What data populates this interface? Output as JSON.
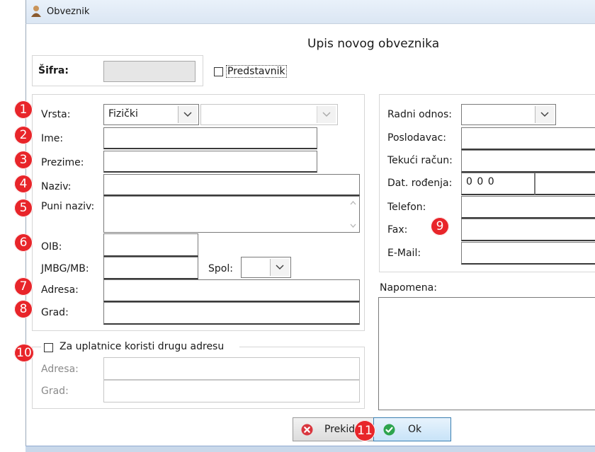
{
  "window": {
    "title": "Obveznik"
  },
  "form": {
    "heading": "Upis novog obveznika",
    "sifra": {
      "label": "Šifra:",
      "value": ""
    },
    "predstavnik": {
      "label": "Predstavnik",
      "checked": false
    },
    "left": {
      "vrsta": {
        "label": "Vrsta:",
        "value": "Fizički",
        "second_value": ""
      },
      "ime": {
        "label": "Ime:",
        "value": ""
      },
      "prezime": {
        "label": "Prezime:",
        "value": ""
      },
      "naziv": {
        "label": "Naziv:",
        "value": ""
      },
      "puni_naziv": {
        "label": "Puni naziv:",
        "value": ""
      },
      "oib": {
        "label": "OIB:",
        "value": ""
      },
      "jmbg": {
        "label": "JMBG/MB:",
        "value": ""
      },
      "spol": {
        "label": "Spol:",
        "value": ""
      },
      "adresa": {
        "label": "Adresa:",
        "value": ""
      },
      "grad": {
        "label": "Grad:",
        "value": ""
      }
    },
    "alt_address": {
      "checkbox_label": "Za uplatnice koristi drugu adresu",
      "checked": false,
      "adresa": {
        "label": "Adresa:",
        "value": ""
      },
      "grad": {
        "label": "Grad:",
        "value": ""
      }
    },
    "right": {
      "radni_odnos": {
        "label": "Radni odnos:",
        "value": ""
      },
      "poslodavac": {
        "label": "Poslodavac:",
        "value": ""
      },
      "tekuci_racun": {
        "label": "Tekući račun:",
        "value": ""
      },
      "dat_rodjenja": {
        "label": "Dat. rođenja:",
        "value": "0 0 0"
      },
      "telefon": {
        "label": "Telefon:",
        "value": ""
      },
      "fax": {
        "label": "Fax:",
        "value": ""
      },
      "email": {
        "label": "E-Mail:",
        "value": ""
      },
      "napomena": {
        "label": "Napomena:",
        "value": ""
      }
    }
  },
  "buttons": {
    "cancel": "Prekid",
    "ok": "Ok"
  },
  "annotations": [
    "1",
    "2",
    "3",
    "4",
    "5",
    "6",
    "7",
    "8",
    "9",
    "10",
    "11"
  ],
  "colors": {
    "badge": "#e8252a",
    "ok_border": "#3c7fb1",
    "cancel_icon": "#d9363e",
    "ok_icon": "#2da44e"
  }
}
